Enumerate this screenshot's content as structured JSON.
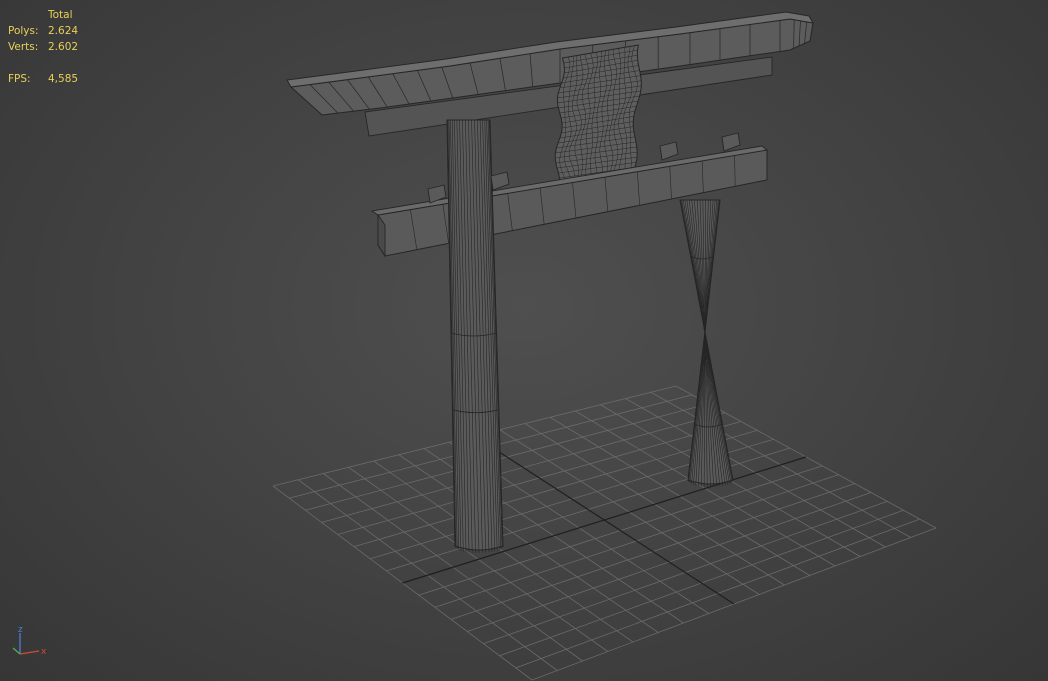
{
  "viewport": {
    "background": "#444444",
    "stats": {
      "header": "Total",
      "polys_label": "Polys:",
      "polys_value": "2.624",
      "verts_label": "Verts:",
      "verts_value": "2.602",
      "fps_label": "FPS:",
      "fps_value": "4,585",
      "color": "#e8d05a"
    },
    "axis_gizmo": {
      "z_label": "z",
      "x_label": "x",
      "z_color": "#4a7fd6",
      "x_color": "#d14a3a",
      "y_color": "#4fb04f"
    },
    "grid": {
      "divisions": 16,
      "line_color": "#6a6a6a",
      "axis_color": "#1e1e1e"
    },
    "model": {
      "icon": "torii-gate-wireframe",
      "surface_color": "#5a5a5a",
      "wire_color": "#262626"
    }
  }
}
